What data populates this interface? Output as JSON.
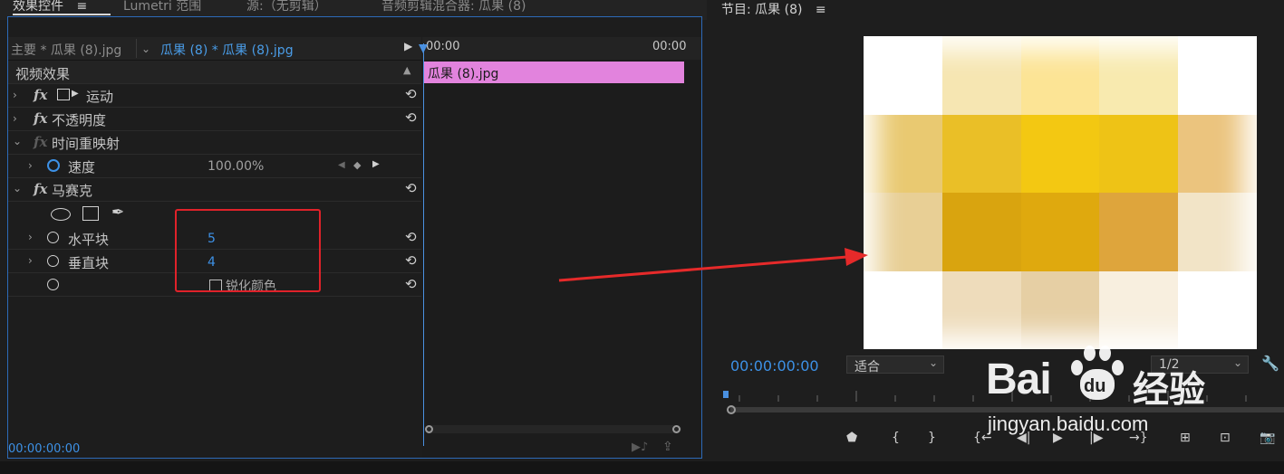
{
  "tabs": {
    "effect_controls": "效果控件",
    "menu_glyph": "≡",
    "lumetri": "Lumetri 范围",
    "source": "源:（无剪辑）",
    "audio_mixer": "音频剪辑混合器: 瓜果 (8)"
  },
  "source_bar": {
    "master": "主要 * 瓜果 (8).jpg",
    "clip": "瓜果 (8) * 瓜果 (8).jpg",
    "play_glyph": "▶"
  },
  "timeline": {
    "start_time": "00:00",
    "end_time": "00:00",
    "clip_label": "瓜果 (8).jpg"
  },
  "effects": {
    "header": "视频效果",
    "motion": "运动",
    "opacity": "不透明度",
    "time_remap": "时间重映射",
    "speed_label": "速度",
    "speed_value": "100.00%",
    "mosaic": "马赛克",
    "horizontal_label": "水平块",
    "horizontal_value": "5",
    "vertical_label": "垂直块",
    "vertical_value": "4",
    "sharpen_label": "锐化颜色",
    "fx_glyph": "fx",
    "reset_glyph": "⟲"
  },
  "footer": {
    "timecode": "00:00:00:00"
  },
  "program": {
    "title": "节目: 瓜果 (8)",
    "menu_glyph": "≡",
    "timecode": "00:00:00:00",
    "fit_select": "适合",
    "quality_select": "1/2",
    "preview_colors": [
      [
        "#ffffff",
        "#f6e6b2",
        "#fce495",
        "#f8eaaf",
        "#ffffff"
      ],
      [
        "#e9c971",
        "#eabf27",
        "#f3c812",
        "#eec316",
        "#ebc47e"
      ],
      [
        "#e8cf95",
        "#d9a40f",
        "#dfa90e",
        "#dea53c",
        "#f2e4c7"
      ],
      [
        "#ffffff",
        "#eedcbb",
        "#e6cfa4",
        "#f8efdf",
        "#ffffff"
      ]
    ]
  },
  "watermark": {
    "brand_a": "Bai",
    "brand_b": "du",
    "brand_cn": "经验",
    "url": "jingyan.baidu.com"
  },
  "colors": {
    "accent_blue": "#3d91e6",
    "clip_pink": "#e283dd",
    "annotation_red": "#e0222a"
  }
}
